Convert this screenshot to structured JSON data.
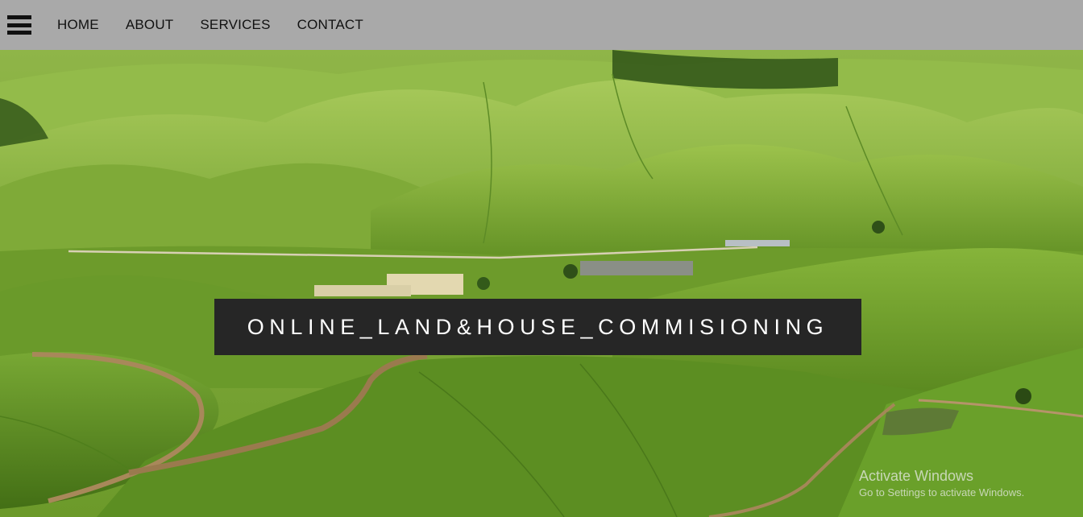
{
  "nav": {
    "menu_icon": "hamburger-menu-icon",
    "links": [
      "HOME",
      "ABOUT",
      "SERVICES",
      "CONTACT"
    ]
  },
  "hero": {
    "background": "rolling green tea-plantation hills",
    "title": "ONLINE_LAND&HOUSE_COMMISIONING"
  },
  "watermark": {
    "title": "Activate Windows",
    "subtitle": "Go to Settings to activate Windows."
  },
  "colors": {
    "navbar_bg": "#a9a9a9",
    "title_box_bg": "#262626",
    "title_text": "#ffffff"
  }
}
